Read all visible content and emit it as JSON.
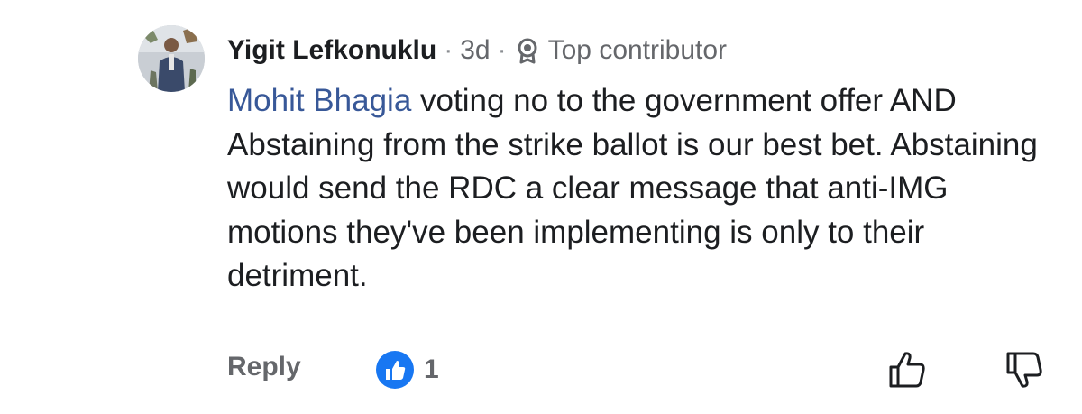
{
  "comment": {
    "author": "Yigit Lefkonuklu",
    "separator": "·",
    "time": "3d",
    "badge_label": "Top contributor",
    "mention": "Mohit Bhagia",
    "text": " voting no to the government offer AND Abstaining from the strike ballot is our best bet. Abstaining would send the RDC a clear message that anti-IMG motions they've been implementing is only to their detriment."
  },
  "actions": {
    "reply_label": "Reply",
    "like_count": "1"
  },
  "icons": {
    "badge": "top-contributor-badge-icon",
    "like_reaction": "like-reaction-icon",
    "thumb_up": "thumbs-up-icon",
    "thumb_down": "thumbs-down-icon"
  },
  "colors": {
    "mention": "#385898",
    "like_blue": "#1877f2",
    "muted_text": "#65676b"
  }
}
